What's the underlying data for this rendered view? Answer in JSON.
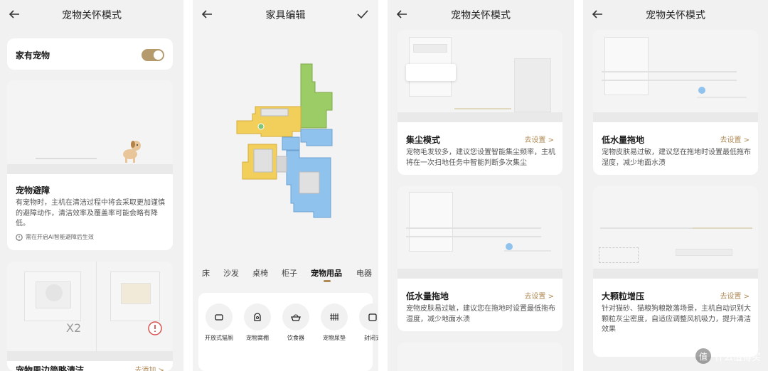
{
  "panel1": {
    "title": "宠物关怀模式",
    "has_pet_label": "家有宠物",
    "card1": {
      "title": "宠物避障",
      "desc": "有宠物时，主机在清洁过程中将会采取更加谨慎的避障动作，清洁效率及覆盖率可能会略有降低。",
      "note": "需在开启AI智能避障后生效"
    },
    "card2": {
      "x2": "X2",
      "title": "宠物周边简略清洁",
      "link": "去添加 >"
    }
  },
  "panel2": {
    "title": "家具编辑",
    "tabs": [
      "床",
      "沙发",
      "桌椅",
      "柜子",
      "宠物用品",
      "电器"
    ],
    "items": [
      "开放式猫厕",
      "宠物窝棚",
      "饮食器",
      "宠物尿垫",
      "封闭式"
    ]
  },
  "panel3": {
    "title": "宠物关怀模式",
    "card1": {
      "title": "集尘模式",
      "link": "去设置 >",
      "desc": "宠物毛发较多，建议您设置智能集尘频率，主机将在一次扫地任务中智能判断多次集尘"
    },
    "card2": {
      "title": "低水量拖地",
      "link": "去设置 >",
      "desc": "宠物皮肤易过敏，建议您在拖地时设置最低拖布湿度，减少地面水渍"
    }
  },
  "panel4": {
    "title": "宠物关怀模式",
    "card1": {
      "title": "低水量拖地",
      "link": "去设置 >",
      "desc": "宠物皮肤易过敏，建议您在拖地时设置最低拖布湿度，减少地面水渍"
    },
    "card2": {
      "title": "大颗粒增压",
      "link": "去设置 >",
      "desc": "针对猫砂、猫粮狗粮散落场景，主机自动识别大颗粒灰尘密度，自适应调整风机吸力，提升清洁效果"
    }
  },
  "watermark": {
    "logo": "值",
    "text": "什么值得买"
  },
  "colors": {
    "accent": "#b08a55",
    "toggle": "#b49a6d",
    "map_yellow": "#f2cf5b",
    "map_green": "#9ccc65",
    "map_blue": "#90c2ee"
  }
}
